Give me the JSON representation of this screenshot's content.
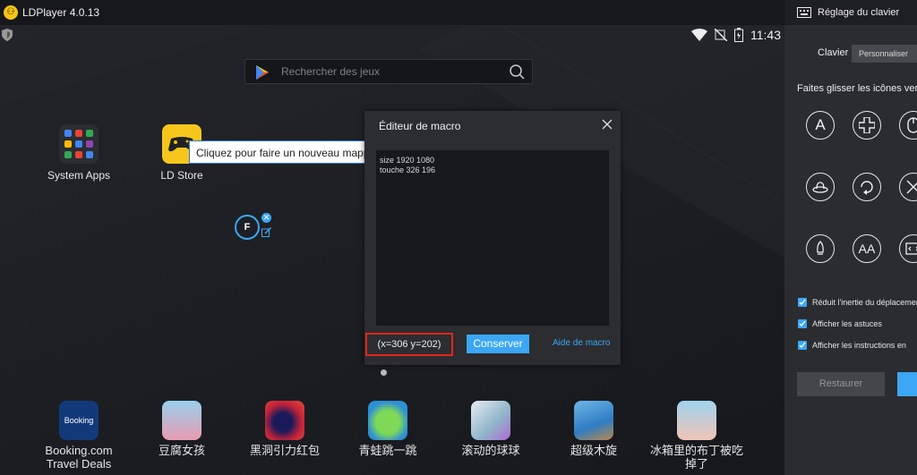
{
  "app": {
    "title": "LDPlayer 4.0.13"
  },
  "status": {
    "time": "11:43"
  },
  "search": {
    "placeholder": "Rechercher des jeux"
  },
  "desktop": {
    "apps": [
      {
        "label": "System Apps"
      },
      {
        "label": "LD Store"
      }
    ],
    "tooltip": "Cliquez pour faire un nouveau mappage",
    "key_mapping": {
      "key": "F"
    }
  },
  "dock": [
    {
      "label": "Booking.com Travel Deals",
      "icon_text": "Booking"
    },
    {
      "label": "豆腐女孩"
    },
    {
      "label": "黑洞引力红包"
    },
    {
      "label": "青蛙跳一跳"
    },
    {
      "label": "滚动的球球"
    },
    {
      "label": "超级木旋"
    },
    {
      "label": "冰箱里的布丁被吃掉了"
    }
  ],
  "macro_editor": {
    "title": "Éditeur de macro",
    "lines": [
      "size 1920 1080",
      "touche 326 196"
    ],
    "coords": "(x=306  y=202)",
    "save_label": "Conserver",
    "help_label": "Aide de macro"
  },
  "panel": {
    "title": "Réglage du clavier",
    "keyboard_label": "Clavier",
    "mode_button": "Personnaliser",
    "drag_hint": "Faites glisser les icônes vers",
    "icons": [
      "key-a-icon",
      "dpad-icon",
      "mouse-icon",
      "hat-icon",
      "rotate-icon",
      "crosshair-icon",
      "rocket-icon",
      "multi-key-icon",
      "macro-icon"
    ],
    "icon_texts": {
      "key": "A",
      "multi": "AA"
    },
    "checkboxes": [
      {
        "label": "Réduit l'inertie du déplacement",
        "checked": true
      },
      {
        "label": "Afficher les astuces",
        "checked": true
      },
      {
        "label": "Afficher les instructions en",
        "checked": true
      }
    ],
    "restore_label": "Restaurer"
  },
  "colors": {
    "accent": "#3ba7f5",
    "highlight": "#e2261f"
  }
}
